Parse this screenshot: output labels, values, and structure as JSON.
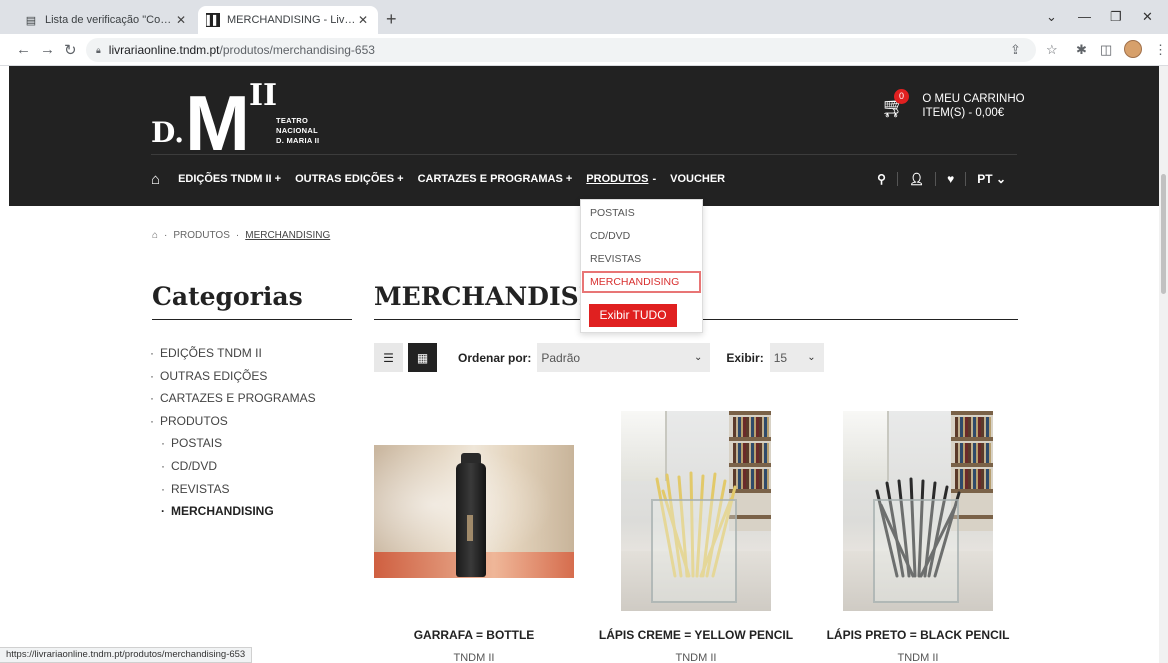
{
  "browser": {
    "tabs": [
      {
        "title": "Lista de verificação \"Conteúdo\"",
        "active": false
      },
      {
        "title": "MERCHANDISING - Livraria do T",
        "active": true
      }
    ],
    "url_host": "livrariaonline.tndm.pt",
    "url_path": "/produtos/merchandising-653",
    "status_url": "https://livrariaonline.tndm.pt/produtos/merchandising-653"
  },
  "logo": {
    "d": "D.",
    "m": "M",
    "ii": "II",
    "sub1": "TEATRO",
    "sub2": "NACIONAL",
    "sub3": "D. MARIA II"
  },
  "cart": {
    "count": "0",
    "line1": "O MEU CARRINHO",
    "line2": "ITEM(S) - 0,00€"
  },
  "nav": {
    "items": [
      "EDIÇÕES TNDM II +",
      "OUTRAS EDIÇÕES +",
      "CARTAZES E PROGRAMAS +",
      "PRODUTOS",
      "-",
      "VOUCHER"
    ],
    "lang": "PT"
  },
  "dropdown": {
    "items": [
      "POSTAIS",
      "CD/DVD",
      "REVISTAS",
      "MERCHANDISING"
    ],
    "button": "Exibir TUDO"
  },
  "breadcrumb": [
    "PRODUTOS",
    "MERCHANDISING"
  ],
  "sidebar": {
    "title": "Categorias",
    "items": [
      "EDIÇÕES TNDM II",
      "OUTRAS EDIÇÕES",
      "CARTAZES E PROGRAMAS",
      "PRODUTOS",
      "POSTAIS",
      "CD/DVD",
      "REVISTAS",
      "MERCHANDISING"
    ]
  },
  "main": {
    "title": "MERCHANDISING",
    "sort_label": "Ordenar por:",
    "sort_value": "Padrão",
    "show_label": "Exibir:",
    "show_value": "15"
  },
  "products": [
    {
      "name": "GARRAFA = BOTTLE",
      "brand": "TNDM II"
    },
    {
      "name": "LÁPIS CREME = YELLOW PENCIL",
      "brand": "TNDM II"
    },
    {
      "name": "LÁPIS PRETO = BLACK PENCIL",
      "brand": "TNDM II"
    }
  ],
  "colors": {
    "header_bg": "#222222",
    "accent_red": "#e02020"
  }
}
